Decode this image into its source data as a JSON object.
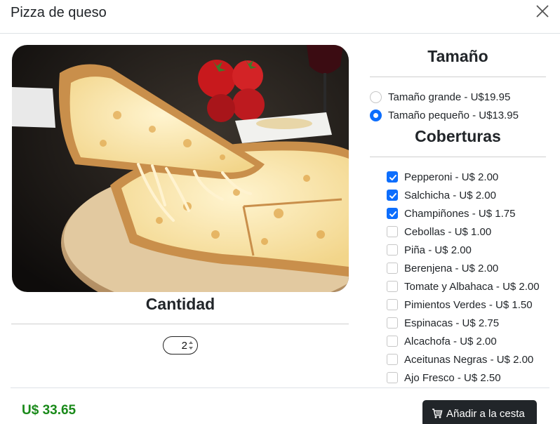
{
  "modal": {
    "title": "Pizza de queso",
    "close_icon": "close-icon"
  },
  "image": {
    "alt": "Pizza de queso"
  },
  "quantity": {
    "heading": "Cantidad",
    "value": "2"
  },
  "size": {
    "heading": "Tamaño",
    "options": [
      {
        "label": "Tamaño grande - U$19.95",
        "selected": false
      },
      {
        "label": "Tamaño pequeño - U$13.95",
        "selected": true
      }
    ]
  },
  "toppings": {
    "heading": "Coberturas",
    "items": [
      {
        "label": "Pepperoni - U$ 2.00",
        "checked": true
      },
      {
        "label": "Salchicha - U$ 2.00",
        "checked": true
      },
      {
        "label": "Champiñones - U$ 1.75",
        "checked": true
      },
      {
        "label": "Cebollas - U$ 1.00",
        "checked": false
      },
      {
        "label": "Piña - U$ 2.00",
        "checked": false
      },
      {
        "label": "Berenjena - U$ 2.00",
        "checked": false
      },
      {
        "label": "Tomate y Albahaca - U$ 2.00",
        "checked": false
      },
      {
        "label": "Pimientos Verdes - U$ 1.50",
        "checked": false
      },
      {
        "label": "Espinacas - U$ 2.75",
        "checked": false
      },
      {
        "label": "Alcachofa - U$ 2.00",
        "checked": false
      },
      {
        "label": "Aceitunas Negras - U$ 2.00",
        "checked": false
      },
      {
        "label": "Ajo Fresco - U$ 2.50",
        "checked": false
      }
    ]
  },
  "footer": {
    "total": "U$ 33.65",
    "add_button_label": "Añadir a la cesta",
    "add_button_icon": "cart-icon"
  },
  "colors": {
    "accent": "#0d6efd",
    "total_text": "#1a8a1a",
    "button_bg": "#212529"
  }
}
